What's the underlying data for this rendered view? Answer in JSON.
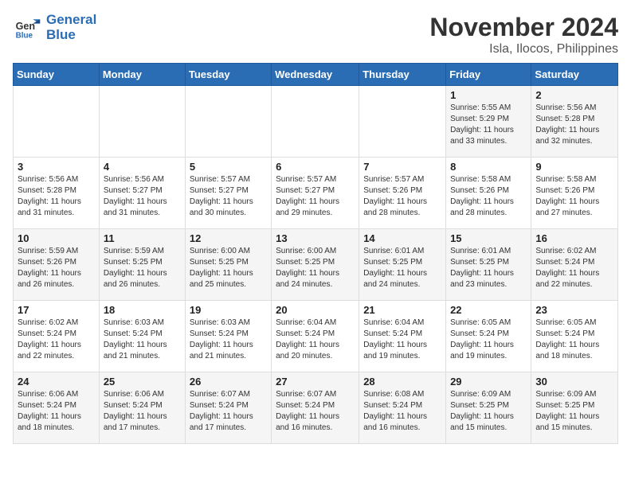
{
  "header": {
    "logo_line1": "General",
    "logo_line2": "Blue",
    "month_year": "November 2024",
    "location": "Isla, Ilocos, Philippines"
  },
  "weekdays": [
    "Sunday",
    "Monday",
    "Tuesday",
    "Wednesday",
    "Thursday",
    "Friday",
    "Saturday"
  ],
  "weeks": [
    [
      {
        "day": "",
        "info": ""
      },
      {
        "day": "",
        "info": ""
      },
      {
        "day": "",
        "info": ""
      },
      {
        "day": "",
        "info": ""
      },
      {
        "day": "",
        "info": ""
      },
      {
        "day": "1",
        "info": "Sunrise: 5:55 AM\nSunset: 5:29 PM\nDaylight: 11 hours and 33 minutes."
      },
      {
        "day": "2",
        "info": "Sunrise: 5:56 AM\nSunset: 5:28 PM\nDaylight: 11 hours and 32 minutes."
      }
    ],
    [
      {
        "day": "3",
        "info": "Sunrise: 5:56 AM\nSunset: 5:28 PM\nDaylight: 11 hours and 31 minutes."
      },
      {
        "day": "4",
        "info": "Sunrise: 5:56 AM\nSunset: 5:27 PM\nDaylight: 11 hours and 31 minutes."
      },
      {
        "day": "5",
        "info": "Sunrise: 5:57 AM\nSunset: 5:27 PM\nDaylight: 11 hours and 30 minutes."
      },
      {
        "day": "6",
        "info": "Sunrise: 5:57 AM\nSunset: 5:27 PM\nDaylight: 11 hours and 29 minutes."
      },
      {
        "day": "7",
        "info": "Sunrise: 5:57 AM\nSunset: 5:26 PM\nDaylight: 11 hours and 28 minutes."
      },
      {
        "day": "8",
        "info": "Sunrise: 5:58 AM\nSunset: 5:26 PM\nDaylight: 11 hours and 28 minutes."
      },
      {
        "day": "9",
        "info": "Sunrise: 5:58 AM\nSunset: 5:26 PM\nDaylight: 11 hours and 27 minutes."
      }
    ],
    [
      {
        "day": "10",
        "info": "Sunrise: 5:59 AM\nSunset: 5:26 PM\nDaylight: 11 hours and 26 minutes."
      },
      {
        "day": "11",
        "info": "Sunrise: 5:59 AM\nSunset: 5:25 PM\nDaylight: 11 hours and 26 minutes."
      },
      {
        "day": "12",
        "info": "Sunrise: 6:00 AM\nSunset: 5:25 PM\nDaylight: 11 hours and 25 minutes."
      },
      {
        "day": "13",
        "info": "Sunrise: 6:00 AM\nSunset: 5:25 PM\nDaylight: 11 hours and 24 minutes."
      },
      {
        "day": "14",
        "info": "Sunrise: 6:01 AM\nSunset: 5:25 PM\nDaylight: 11 hours and 24 minutes."
      },
      {
        "day": "15",
        "info": "Sunrise: 6:01 AM\nSunset: 5:25 PM\nDaylight: 11 hours and 23 minutes."
      },
      {
        "day": "16",
        "info": "Sunrise: 6:02 AM\nSunset: 5:24 PM\nDaylight: 11 hours and 22 minutes."
      }
    ],
    [
      {
        "day": "17",
        "info": "Sunrise: 6:02 AM\nSunset: 5:24 PM\nDaylight: 11 hours and 22 minutes."
      },
      {
        "day": "18",
        "info": "Sunrise: 6:03 AM\nSunset: 5:24 PM\nDaylight: 11 hours and 21 minutes."
      },
      {
        "day": "19",
        "info": "Sunrise: 6:03 AM\nSunset: 5:24 PM\nDaylight: 11 hours and 21 minutes."
      },
      {
        "day": "20",
        "info": "Sunrise: 6:04 AM\nSunset: 5:24 PM\nDaylight: 11 hours and 20 minutes."
      },
      {
        "day": "21",
        "info": "Sunrise: 6:04 AM\nSunset: 5:24 PM\nDaylight: 11 hours and 19 minutes."
      },
      {
        "day": "22",
        "info": "Sunrise: 6:05 AM\nSunset: 5:24 PM\nDaylight: 11 hours and 19 minutes."
      },
      {
        "day": "23",
        "info": "Sunrise: 6:05 AM\nSunset: 5:24 PM\nDaylight: 11 hours and 18 minutes."
      }
    ],
    [
      {
        "day": "24",
        "info": "Sunrise: 6:06 AM\nSunset: 5:24 PM\nDaylight: 11 hours and 18 minutes."
      },
      {
        "day": "25",
        "info": "Sunrise: 6:06 AM\nSunset: 5:24 PM\nDaylight: 11 hours and 17 minutes."
      },
      {
        "day": "26",
        "info": "Sunrise: 6:07 AM\nSunset: 5:24 PM\nDaylight: 11 hours and 17 minutes."
      },
      {
        "day": "27",
        "info": "Sunrise: 6:07 AM\nSunset: 5:24 PM\nDaylight: 11 hours and 16 minutes."
      },
      {
        "day": "28",
        "info": "Sunrise: 6:08 AM\nSunset: 5:24 PM\nDaylight: 11 hours and 16 minutes."
      },
      {
        "day": "29",
        "info": "Sunrise: 6:09 AM\nSunset: 5:25 PM\nDaylight: 11 hours and 15 minutes."
      },
      {
        "day": "30",
        "info": "Sunrise: 6:09 AM\nSunset: 5:25 PM\nDaylight: 11 hours and 15 minutes."
      }
    ]
  ]
}
